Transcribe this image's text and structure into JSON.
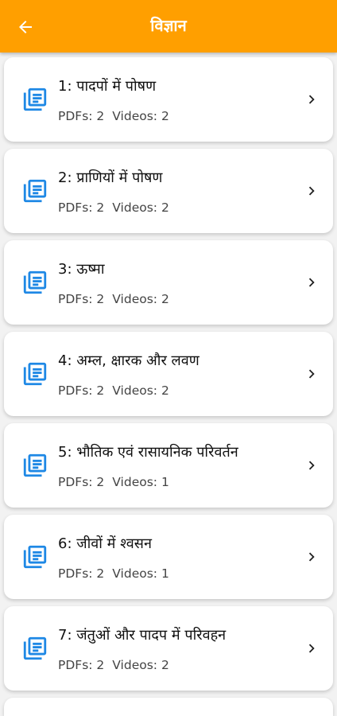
{
  "appbar": {
    "title": "विज्ञान",
    "back_icon": "arrow-left-icon",
    "color": "#ff9f00"
  },
  "chapters": [
    {
      "name": "1: पादपों में पोषण",
      "pdfs": "PDFs: 2",
      "videos": "Videos: 2"
    },
    {
      "name": "2: प्राणियों में पोषण",
      "pdfs": "PDFs: 2",
      "videos": "Videos: 2"
    },
    {
      "name": "3: ऊष्मा",
      "pdfs": "PDFs: 2",
      "videos": "Videos: 2"
    },
    {
      "name": "4: अम्ल, क्षारक और लवण",
      "pdfs": "PDFs: 2",
      "videos": "Videos: 2"
    },
    {
      "name": "5: भौतिक एवं रासायनिक परिवर्तन",
      "pdfs": "PDFs: 2",
      "videos": "Videos: 1"
    },
    {
      "name": "6: जीवों में श्वसन",
      "pdfs": "PDFs: 2",
      "videos": "Videos: 1"
    },
    {
      "name": "7: जंतुओं और पादप में परिवहन",
      "pdfs": "PDFs: 2",
      "videos": "Videos: 2"
    }
  ],
  "icons": {
    "chapter": "library-books-icon",
    "open": "chevron-right-icon",
    "icon_color": "#1e88e5"
  }
}
